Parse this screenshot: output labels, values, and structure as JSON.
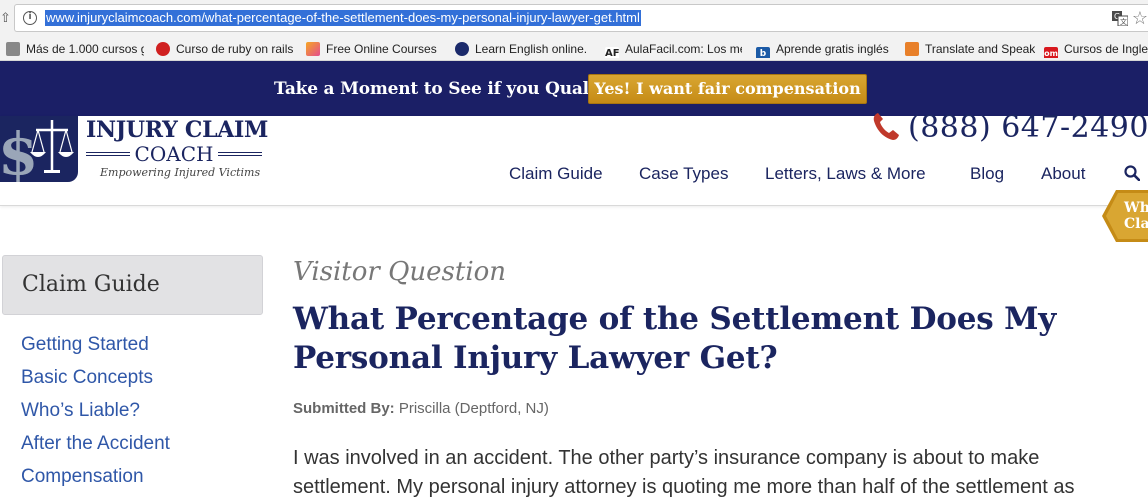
{
  "browser": {
    "url": "www.injuryclaimcoach.com/what-percentage-of-the-settlement-does-my-personal-injury-lawyer-get.html",
    "bookmarks": [
      {
        "label": "Más de 1.000 cursos g",
        "icon": "bookmark-folder-icon"
      },
      {
        "label": "Curso de ruby on rails",
        "icon": "ruby-icon"
      },
      {
        "label": "Free Online Courses -",
        "icon": "courses-icon"
      },
      {
        "label": "Learn English online.",
        "icon": "globe-icon"
      },
      {
        "label": "AulaFacil.com: Los me",
        "icon": "af-icon",
        "icon_text": "AF"
      },
      {
        "label": "Aprende gratis inglés",
        "icon": "b-icon",
        "icon_text": "b"
      },
      {
        "label": "Translate and Speak",
        "icon": "translate-speak-icon"
      },
      {
        "label": "Cursos de Ingle",
        "icon": "om-icon",
        "icon_text": "om"
      }
    ]
  },
  "promo": {
    "text": "Take a Moment to See if you Qualify",
    "button": "Yes! I want fair compensation"
  },
  "header": {
    "logo_title": "INJURY CLAIM",
    "logo_sub": "COACH",
    "logo_tagline": "Empowering Injured Victims",
    "phone": "(888) 647-2490",
    "nav": [
      "Claim Guide",
      "Case Types",
      "Letters, Laws & More",
      "Blog",
      "About"
    ],
    "side_tab": [
      "Wh",
      "Cla"
    ]
  },
  "sidebar": {
    "title": "Claim Guide",
    "links": [
      "Getting Started",
      "Basic Concepts",
      "Who’s Liable?",
      "After the Accident",
      "Compensation"
    ]
  },
  "article": {
    "kicker": "Visitor Question",
    "headline": "What Percentage of the Settlement Does My Personal Injury Lawyer Get?",
    "submitted_label": "Submitted By:",
    "submitted_value": "Priscilla (Deptford, NJ)",
    "body_lines": [
      "I was involved in an accident. The other party’s insurance company is about to make",
      "settlement. My personal injury attorney is quoting me more than half of the settlement as"
    ]
  },
  "colors": {
    "navy": "#1b2560",
    "gold": "#c58b16",
    "link": "#2f57a8",
    "phone_icon": "#c0392b"
  }
}
